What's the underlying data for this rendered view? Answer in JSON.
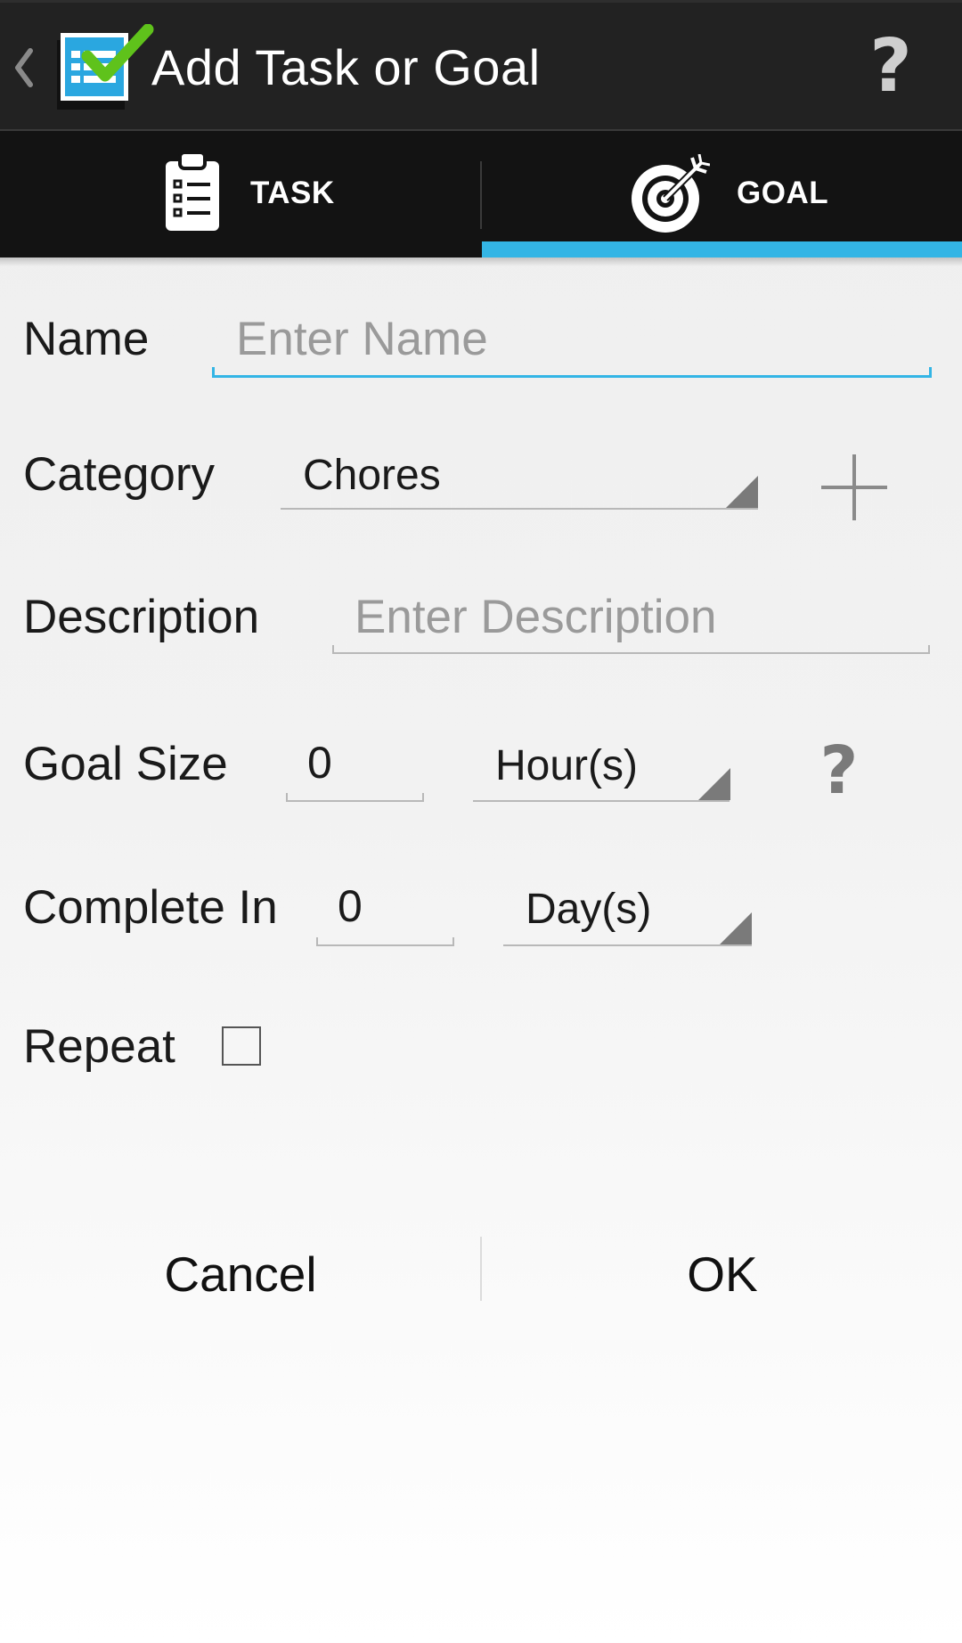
{
  "action_bar": {
    "title": "Add Task or Goal",
    "help": "?",
    "icons": {
      "back": "chevron-left-icon",
      "app": "checklist-app-icon"
    }
  },
  "tabs": [
    {
      "label": "TASK",
      "icon": "clipboard-list-icon",
      "selected": false
    },
    {
      "label": "GOAL",
      "icon": "target-arrow-icon",
      "selected": true
    }
  ],
  "form": {
    "name": {
      "label": "Name",
      "placeholder": "Enter Name",
      "value": ""
    },
    "category": {
      "label": "Category",
      "selected": "Chores",
      "add_icon": "plus-icon"
    },
    "description": {
      "label": "Description",
      "placeholder": "Enter Description",
      "value": ""
    },
    "goal_size": {
      "label": "Goal Size",
      "value": "0",
      "unit": "Hour(s)",
      "help": "?"
    },
    "complete_in": {
      "label": "Complete In",
      "value": "0",
      "unit": "Day(s)"
    },
    "repeat": {
      "label": "Repeat",
      "checked": false
    }
  },
  "buttons": {
    "cancel": "Cancel",
    "ok": "OK"
  },
  "colors": {
    "accent": "#33b5e5",
    "action_bar": "#222222",
    "tab_bar": "#131313",
    "check_green": "#5fc21b"
  }
}
